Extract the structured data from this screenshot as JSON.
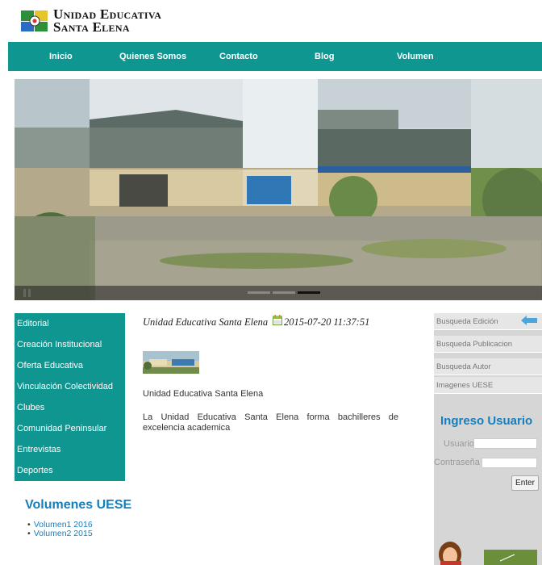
{
  "header": {
    "logo_line1": "Unidad Educativa",
    "logo_line2": "Santa Elena"
  },
  "nav": {
    "items": [
      "Inicio",
      "Quienes Somos",
      "Contacto",
      "Blog",
      "Volumen"
    ]
  },
  "sidebar": {
    "menu": [
      "Editorial",
      "Creación Institucional",
      "Oferta Educativa",
      "Vinculación Colectividad",
      "Clubes",
      "Comunidad Peninsular",
      "Entrevistas",
      "Deportes"
    ],
    "volumes_title": "Volumenes UESE",
    "volumes": [
      "Volumen1 2016",
      "Volumen2 2015"
    ]
  },
  "article": {
    "title": "Unidad Educativa Santa Elena",
    "date": "2015-07-20 11:37:51",
    "subtitle": "Unidad Educativa Santa Elena",
    "body": "La Unidad Educativa Santa Elena forma bachilleres de excelencia academica"
  },
  "right_panel": {
    "search_items": [
      "Busqueda Edición",
      "Busqueda Publicacion",
      "Busqueda Autor",
      "Imagenes UESE"
    ],
    "login_title": "Ingreso Usuario",
    "user_label": "Usuario",
    "password_label": "Contraseña",
    "enter_label": "Enter"
  },
  "colors": {
    "nav_bg": "#0f9690",
    "link_blue": "#137fbf"
  }
}
